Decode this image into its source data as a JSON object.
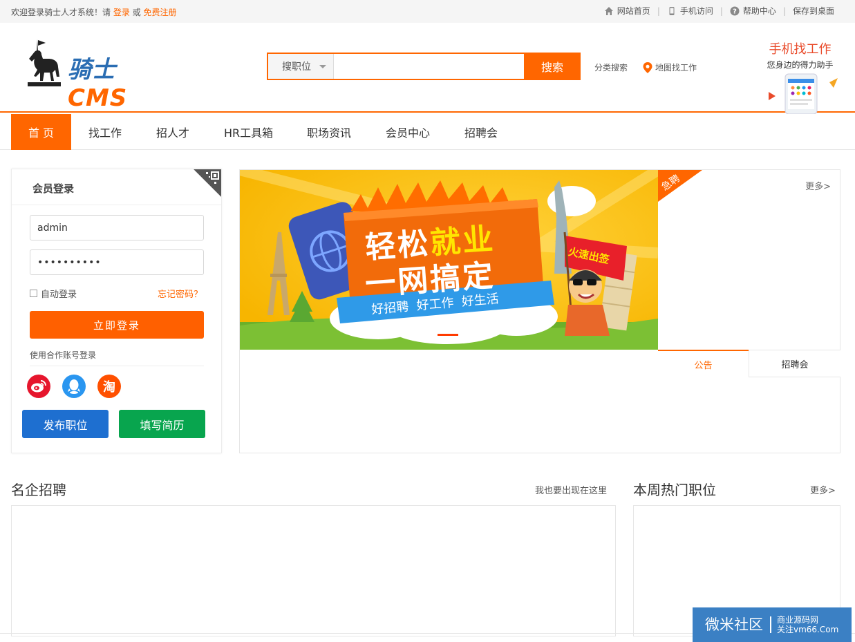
{
  "topbar": {
    "welcome_prefix": "欢迎登录骑士人才系统！请",
    "login_link": "登录",
    "or": "或",
    "register_link": "免费注册",
    "links": [
      "网站首页",
      "手机访问",
      "帮助中心",
      "保存到桌面"
    ],
    "separator": "|"
  },
  "header": {
    "logo_main": "骑士",
    "logo_cms": "CMS",
    "search": {
      "type_label": "搜职位",
      "placeholder": "",
      "button": "搜索"
    },
    "category_search": "分类搜索",
    "map_search": "地图找工作",
    "mobile_title": "手机找工作",
    "mobile_subtitle": "您身边的得力助手"
  },
  "nav": {
    "items": [
      "首 页",
      "找工作",
      "招人才",
      "HR工具箱",
      "职场资讯",
      "会员中心",
      "招聘会"
    ]
  },
  "login": {
    "title": "会员登录",
    "username_value": "admin",
    "password_value": "••••••••••",
    "auto_login": "自动登录",
    "forgot": "忘记密码？",
    "submit": "立即登录",
    "coop_login": "使用合作账号登录",
    "social": [
      "weibo-icon",
      "qq-icon",
      "taobao-icon"
    ],
    "taobao_glyph": "淘",
    "post_job": "发布职位",
    "fill_resume": "填写简历",
    "colors": {
      "orange": "#ff6000",
      "blue": "#1e6fd0",
      "green": "#08a54e"
    }
  },
  "banner": {
    "line1_a": "轻松",
    "line1_b": "就业",
    "line2": "一网搞定",
    "ribbon": "好招聘  好工作  好生活",
    "flag": "火速出签"
  },
  "urgent": {
    "badge": "急聘",
    "more": "更多>"
  },
  "tabs": {
    "notice": "公告",
    "fair": "招聘会"
  },
  "famous": {
    "title": "名企招聘",
    "link": "我也要出现在这里"
  },
  "hotjobs": {
    "title": "本周热门职位",
    "more": "更多>"
  },
  "watermark": {
    "main": "微米社区",
    "line1": "商业源码网",
    "line2": "关注vm66.Com"
  }
}
